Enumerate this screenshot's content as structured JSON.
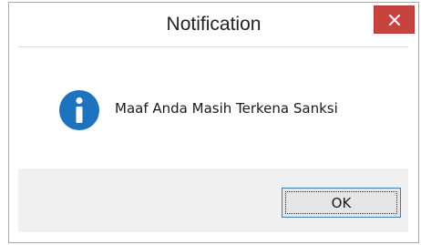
{
  "window": {
    "title": "Notification",
    "close_icon": "close-icon",
    "close_color": "#c7433d"
  },
  "content": {
    "icon": "info-icon",
    "icon_color": "#1e73be",
    "message": "Maaf Anda Masih Terkena Sanksi"
  },
  "footer": {
    "ok_label": "OK",
    "ok_border_color": "#3c7fb1"
  }
}
